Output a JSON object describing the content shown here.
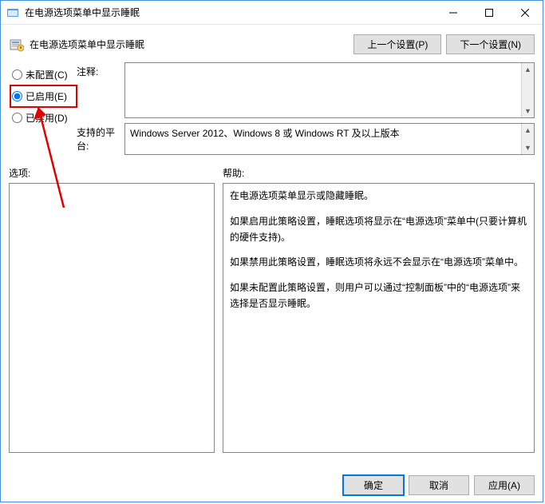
{
  "window": {
    "title": "在电源选项菜单中显示睡眠"
  },
  "header": {
    "label": "在电源选项菜单中显示睡眠",
    "prev_setting": "上一个设置(P)",
    "next_setting": "下一个设置(N)"
  },
  "config": {
    "not_configured": {
      "label": "未配置(C)",
      "selected": false
    },
    "enabled": {
      "label": "已启用(E)",
      "selected": true
    },
    "disabled": {
      "label": "已禁用(D)",
      "selected": false
    }
  },
  "fields": {
    "comment_label": "注释:",
    "comment_value": "",
    "platform_label": "支持的平台:",
    "platform_value": "Windows Server 2012、Windows 8 或 Windows RT 及以上版本"
  },
  "panes": {
    "options_label": "选项:",
    "help_label": "帮助:",
    "help_paragraphs": [
      "在电源选项菜单显示或隐藏睡眠。",
      "如果启用此策略设置，睡眠选项将显示在“电源选项”菜单中(只要计算机的硬件支持)。",
      "如果禁用此策略设置，睡眠选项将永远不会显示在“电源选项”菜单中。",
      "如果未配置此策略设置，则用户可以通过“控制面板”中的“电源选项”来选择是否显示睡眠。"
    ]
  },
  "footer": {
    "ok": "确定",
    "cancel": "取消",
    "apply": "应用(A)"
  }
}
